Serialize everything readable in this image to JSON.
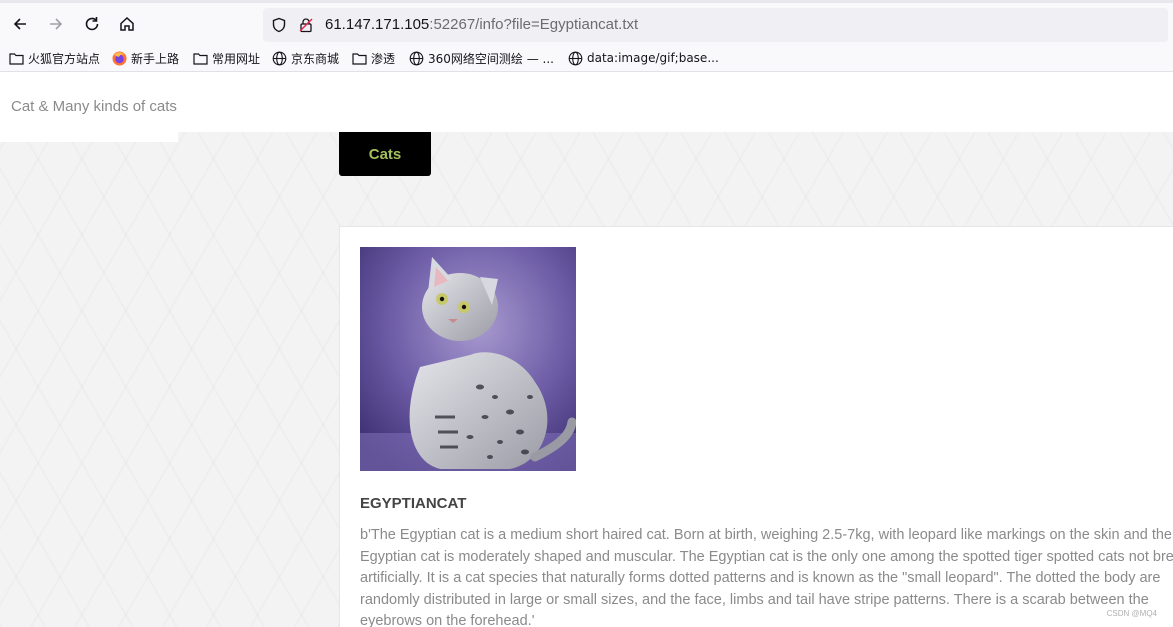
{
  "browser": {
    "url_host": "61.147.171.105",
    "url_rest": ":52267/info?file=Egyptiancat.txt",
    "bookmarks": [
      {
        "label": "火狐官方站点",
        "icon": "folder-icon"
      },
      {
        "label": "新手上路",
        "icon": "firefox-icon"
      },
      {
        "label": "常用网址",
        "icon": "folder-icon"
      },
      {
        "label": "京东商城",
        "icon": "globe-icon"
      },
      {
        "label": "渗透",
        "icon": "folder-icon"
      },
      {
        "label": "360网络空间测绘 — ...",
        "icon": "globe-icon"
      },
      {
        "label": "data:image/gif;base...",
        "icon": "globe-icon"
      }
    ]
  },
  "site": {
    "brand": "Cat & Many kinds of cats",
    "nav_label": "Cats"
  },
  "article": {
    "title": "EGYPTIANCAT",
    "body": "b'The Egyptian cat is a medium short haired cat. Born at birth, weighing 2.5-7kg, with leopard like markings on the skin and the Egyptian cat is moderately shaped and muscular. The Egyptian cat is the only one among the spotted tiger spotted cats not breed artificially. It is a cat species that naturally forms dotted patterns and is known as the \"small leopard\". The dotted the body are randomly distributed in large or small sizes, and the face, limbs and tail have stripe patterns. There is a scarab between the eyebrows on the forehead.'"
  },
  "watermark": "CSDN @MQ4",
  "colors": {
    "nav_bg": "#000000",
    "nav_text": "#a4c05a",
    "photo_bg": "#6a5a9a"
  }
}
